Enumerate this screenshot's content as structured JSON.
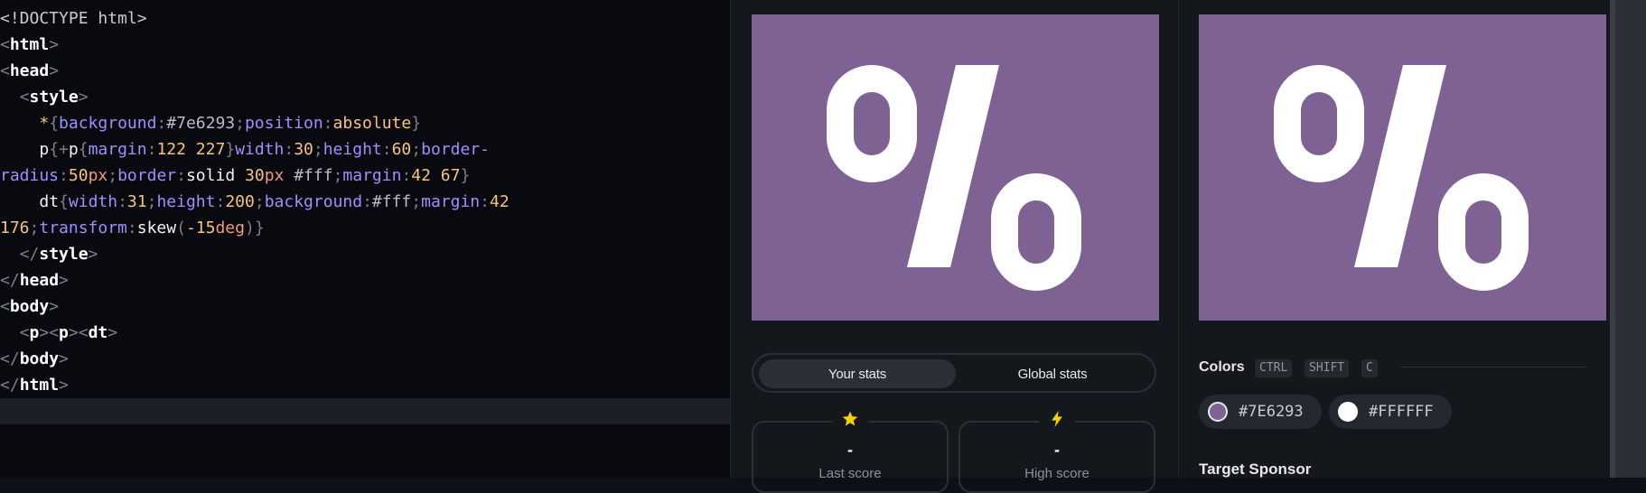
{
  "editor": {
    "lines": [
      [
        {
          "t": "<!DOCTYPE html>",
          "c": "c-str"
        }
      ],
      [
        {
          "t": "<",
          "c": "c-br"
        },
        {
          "t": "html",
          "c": "c-tag"
        },
        {
          "t": ">",
          "c": "c-br"
        }
      ],
      [
        {
          "t": "<",
          "c": "c-br"
        },
        {
          "t": "head",
          "c": "c-tag"
        },
        {
          "t": ">",
          "c": "c-br"
        }
      ],
      [
        {
          "t": "  <",
          "c": "c-br"
        },
        {
          "t": "style",
          "c": "c-tag"
        },
        {
          "t": ">",
          "c": "c-br"
        }
      ],
      [
        {
          "t": "    ",
          "c": ""
        },
        {
          "t": "*",
          "c": "c-sel"
        },
        {
          "t": "{",
          "c": "c-br"
        },
        {
          "t": "background",
          "c": "c-prop"
        },
        {
          "t": ":",
          "c": "c-br"
        },
        {
          "t": "#7e6293",
          "c": "c-hex"
        },
        {
          "t": ";",
          "c": "c-br"
        },
        {
          "t": "position",
          "c": "c-prop"
        },
        {
          "t": ":",
          "c": "c-br"
        },
        {
          "t": "absolute",
          "c": "c-num"
        },
        {
          "t": "}",
          "c": "c-br"
        }
      ],
      [
        {
          "t": "    ",
          "c": ""
        },
        {
          "t": "p",
          "c": "c-fn"
        },
        {
          "t": "{",
          "c": "c-br"
        },
        {
          "t": "+",
          "c": "c-br"
        },
        {
          "t": "p",
          "c": "c-fn"
        },
        {
          "t": "{",
          "c": "c-br"
        },
        {
          "t": "margin",
          "c": "c-prop"
        },
        {
          "t": ":",
          "c": "c-br"
        },
        {
          "t": "122 227",
          "c": "c-num"
        },
        {
          "t": "}",
          "c": "c-br"
        },
        {
          "t": "width",
          "c": "c-prop"
        },
        {
          "t": ":",
          "c": "c-br"
        },
        {
          "t": "30",
          "c": "c-num"
        },
        {
          "t": ";",
          "c": "c-br"
        },
        {
          "t": "height",
          "c": "c-prop"
        },
        {
          "t": ":",
          "c": "c-br"
        },
        {
          "t": "60",
          "c": "c-num"
        },
        {
          "t": ";",
          "c": "c-br"
        },
        {
          "t": "border-",
          "c": "c-prop"
        }
      ],
      [
        {
          "t": "radius",
          "c": "c-prop"
        },
        {
          "t": ":",
          "c": "c-br"
        },
        {
          "t": "50",
          "c": "c-num"
        },
        {
          "t": "px",
          "c": "c-unit"
        },
        {
          "t": ";",
          "c": "c-br"
        },
        {
          "t": "border",
          "c": "c-prop"
        },
        {
          "t": ":",
          "c": "c-br"
        },
        {
          "t": "solid ",
          "c": "c-fn"
        },
        {
          "t": "30",
          "c": "c-num"
        },
        {
          "t": "px ",
          "c": "c-unit"
        },
        {
          "t": "#fff",
          "c": "c-hex"
        },
        {
          "t": ";",
          "c": "c-br"
        },
        {
          "t": "margin",
          "c": "c-prop"
        },
        {
          "t": ":",
          "c": "c-br"
        },
        {
          "t": "42 67",
          "c": "c-num"
        },
        {
          "t": "}",
          "c": "c-br"
        }
      ],
      [
        {
          "t": "    ",
          "c": ""
        },
        {
          "t": "dt",
          "c": "c-fn"
        },
        {
          "t": "{",
          "c": "c-br"
        },
        {
          "t": "width",
          "c": "c-prop"
        },
        {
          "t": ":",
          "c": "c-br"
        },
        {
          "t": "31",
          "c": "c-num"
        },
        {
          "t": ";",
          "c": "c-br"
        },
        {
          "t": "height",
          "c": "c-prop"
        },
        {
          "t": ":",
          "c": "c-br"
        },
        {
          "t": "200",
          "c": "c-num"
        },
        {
          "t": ";",
          "c": "c-br"
        },
        {
          "t": "background",
          "c": "c-prop"
        },
        {
          "t": ":",
          "c": "c-br"
        },
        {
          "t": "#fff",
          "c": "c-hex"
        },
        {
          "t": ";",
          "c": "c-br"
        },
        {
          "t": "margin",
          "c": "c-prop"
        },
        {
          "t": ":",
          "c": "c-br"
        },
        {
          "t": "42",
          "c": "c-num"
        }
      ],
      [
        {
          "t": "176",
          "c": "c-num"
        },
        {
          "t": ";",
          "c": "c-br"
        },
        {
          "t": "transform",
          "c": "c-prop"
        },
        {
          "t": ":",
          "c": "c-br"
        },
        {
          "t": "skew",
          "c": "c-fn"
        },
        {
          "t": "(",
          "c": "c-br"
        },
        {
          "t": "-15",
          "c": "c-num"
        },
        {
          "t": "deg",
          "c": "c-unit"
        },
        {
          "t": ")",
          "c": "c-br"
        },
        {
          "t": "}",
          "c": "c-br"
        }
      ],
      [
        {
          "t": "  </",
          "c": "c-br"
        },
        {
          "t": "style",
          "c": "c-tag"
        },
        {
          "t": ">",
          "c": "c-br"
        }
      ],
      [
        {
          "t": "</",
          "c": "c-br"
        },
        {
          "t": "head",
          "c": "c-tag"
        },
        {
          "t": ">",
          "c": "c-br"
        }
      ],
      [
        {
          "t": "<",
          "c": "c-br"
        },
        {
          "t": "body",
          "c": "c-tag"
        },
        {
          "t": ">",
          "c": "c-br"
        }
      ],
      [
        {
          "t": "  <",
          "c": "c-br"
        },
        {
          "t": "p",
          "c": "c-tag"
        },
        {
          "t": "><",
          "c": "c-br"
        },
        {
          "t": "p",
          "c": "c-tag"
        },
        {
          "t": "><",
          "c": "c-br"
        },
        {
          "t": "dt",
          "c": "c-tag"
        },
        {
          "t": ">",
          "c": "c-br"
        }
      ],
      [
        {
          "t": "</",
          "c": "c-br"
        },
        {
          "t": "body",
          "c": "c-tag"
        },
        {
          "t": ">",
          "c": "c-br"
        }
      ],
      [
        {
          "t": "</",
          "c": "c-br"
        },
        {
          "t": "html",
          "c": "c-tag"
        },
        {
          "t": ">",
          "c": "c-br"
        }
      ],
      []
    ]
  },
  "tabs": {
    "your_stats": "Your stats",
    "global_stats": "Global stats"
  },
  "stats": {
    "last": {
      "icon": "star-icon",
      "value": "-",
      "label": "Last score"
    },
    "high": {
      "icon": "lightning-icon",
      "value": "-",
      "label": "High score"
    }
  },
  "colors": {
    "title": "Colors",
    "shortcut_keys": [
      "CTRL",
      "SHIFT",
      "C"
    ],
    "swatches": [
      {
        "hex": "#7E6293"
      },
      {
        "hex": "#FFFFFF"
      }
    ]
  },
  "sponsor": {
    "title": "Target Sponsor"
  },
  "theme": {
    "target_bg": "#7e6293",
    "target_fg": "#ffffff",
    "star_color": "#f5d300"
  }
}
